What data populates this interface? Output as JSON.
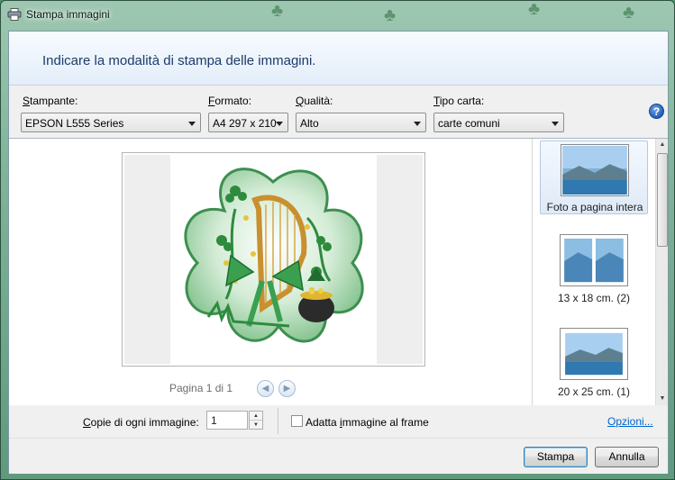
{
  "window": {
    "title": "Stampa immagini"
  },
  "header": {
    "text": "Indicare la modalità di stampa delle immagini."
  },
  "fields": {
    "printer": {
      "label_key": "S",
      "label_rest": "tampante:",
      "value": "EPSON L555 Series"
    },
    "format": {
      "label_key": "F",
      "label_rest": "ormato:",
      "value": "A4 297 x 210"
    },
    "quality": {
      "label_key": "Q",
      "label_rest": "ualità:",
      "value": "Alto"
    },
    "paper_type": {
      "label_key": "T",
      "label_rest": "ipo carta:",
      "value": "carte comuni"
    },
    "help_icon": "?"
  },
  "preview": {
    "page_label": "Pagina 1 di 1",
    "prev_icon": "◀",
    "next_icon": "▶"
  },
  "layouts": [
    {
      "label": "Foto a pagina intera",
      "selected": true
    },
    {
      "label": "13 x 18 cm. (2)",
      "selected": false
    },
    {
      "label": "20 x 25 cm. (1)",
      "selected": false
    }
  ],
  "bottom": {
    "copies_key": "C",
    "copies_rest": "opie di ogni immagine:",
    "copies_value": "1",
    "fit_pre": "Adatta ",
    "fit_key": "i",
    "fit_rest": "mmagine al frame",
    "fit_checked": false,
    "options_key": "O",
    "options_rest": "pzioni..."
  },
  "buttons": {
    "print": "Stampa",
    "cancel": "Annulla"
  },
  "colors": {
    "header_text": "#1d3b6a",
    "link": "#0066cc",
    "accent_green": "#2e8b3e"
  }
}
